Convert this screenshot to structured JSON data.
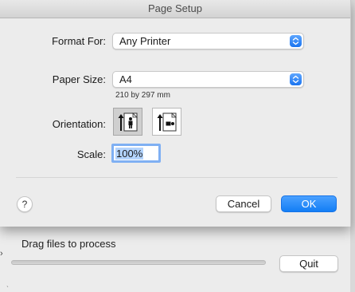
{
  "dialog": {
    "title": "Page Setup",
    "format_for": {
      "label": "Format For:",
      "value": "Any Printer"
    },
    "paper_size": {
      "label": "Paper Size:",
      "value": "A4",
      "dimensions": "210 by 297 mm"
    },
    "orientation": {
      "label": "Orientation:",
      "options": [
        "portrait",
        "landscape"
      ],
      "selected": "portrait"
    },
    "scale": {
      "label": "Scale:",
      "value": "100%"
    },
    "help_label": "?",
    "cancel_label": "Cancel",
    "ok_label": "OK"
  },
  "background_window": {
    "drop_label": "Drag files to process",
    "quit_label": "Quit"
  },
  "colors": {
    "accent": "#1a7ef5",
    "selection": "#b4d4fd",
    "focus_ring": "#7fb0f3"
  },
  "icons": [
    "up-down-chevron-icon",
    "portrait-orientation-icon",
    "landscape-orientation-icon",
    "help-icon"
  ]
}
